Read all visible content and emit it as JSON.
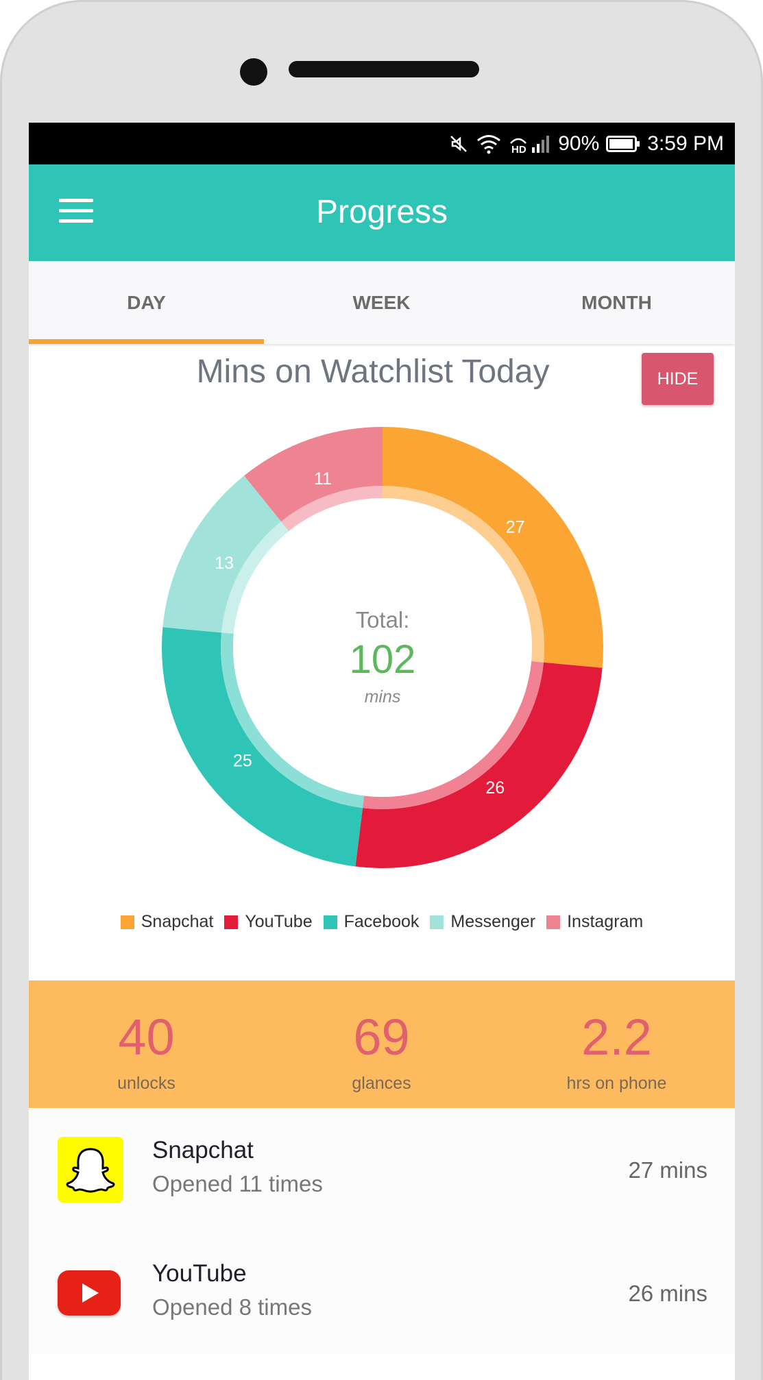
{
  "status_bar": {
    "battery": "90%",
    "time": "3:59 PM"
  },
  "app_bar": {
    "title": "Progress"
  },
  "tabs": [
    {
      "label": "DAY",
      "active": true
    },
    {
      "label": "WEEK",
      "active": false
    },
    {
      "label": "MONTH",
      "active": false
    }
  ],
  "chart_header": {
    "title": "Mins on Watchlist Today",
    "hide_label": "HIDE"
  },
  "donut_center": {
    "label": "Total:",
    "value": "102",
    "unit": "mins"
  },
  "chart_data": {
    "type": "pie",
    "title": "Mins on Watchlist Today",
    "categories": [
      "Snapchat",
      "YouTube",
      "Facebook",
      "Messenger",
      "Instagram"
    ],
    "values": [
      27,
      26,
      25,
      13,
      11
    ],
    "colors": [
      "#fba634",
      "#e31b3a",
      "#2ec4b6",
      "#a1e3da",
      "#ee8492"
    ],
    "total": 102,
    "legend": "bottom"
  },
  "stats": [
    {
      "value": "40",
      "label": "unlocks"
    },
    {
      "value": "69",
      "label": "glances"
    },
    {
      "value": "2.2",
      "label": "hrs on phone"
    }
  ],
  "apps": [
    {
      "name": "Snapchat",
      "opened": "Opened 11 times",
      "mins": "27 mins",
      "icon": "snapchat-icon"
    },
    {
      "name": "YouTube",
      "opened": "Opened 8 times",
      "mins": "26 mins",
      "icon": "youtube-icon"
    }
  ],
  "colors": {
    "accent": "#2ec4b6",
    "tab_indicator": "#f7a532",
    "stats_bg": "#fdba5f",
    "stat_value": "#e0606e",
    "total_value": "#5cb85c"
  }
}
